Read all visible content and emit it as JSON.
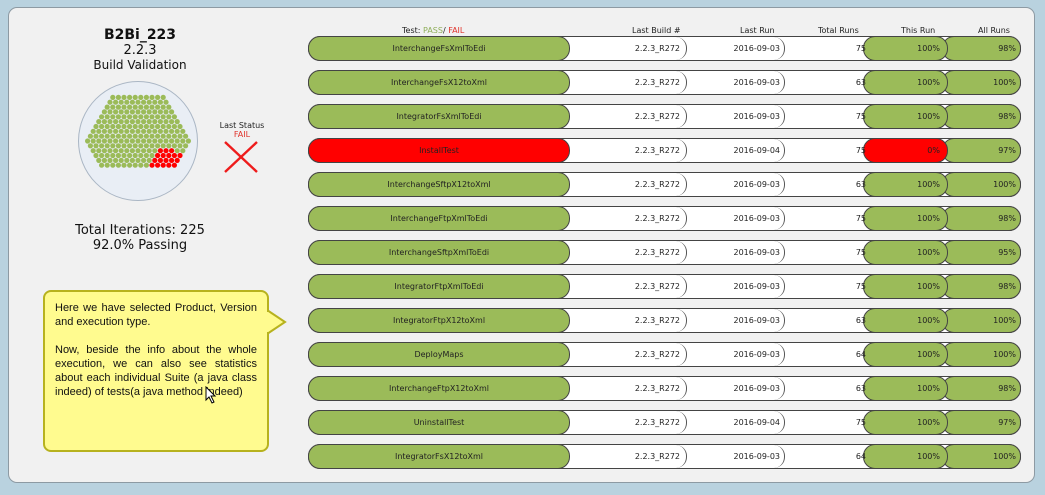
{
  "summary": {
    "product": "B2Bi_223",
    "version": "2.2.3",
    "execution_type": "Build Validation",
    "last_status_label": "Last Status",
    "last_status_value": "FAIL",
    "total_iterations": "Total Iterations: 225",
    "passing": "92.0% Passing"
  },
  "colors": {
    "pass": "#9bbb59",
    "fail": "#ff0000",
    "panel": "#f1f1f1",
    "background": "#b9d2df",
    "callout": "#fffb8f"
  },
  "headers": {
    "test_prefix": "Test: ",
    "pass": "PASS",
    "slash": "/ ",
    "fail": "FAIL",
    "last_build": "Last Build #",
    "last_run": "Last Run",
    "total_runs": "Total Runs",
    "this_run": "This Run",
    "all_runs": "All Runs"
  },
  "rows": [
    {
      "name": "InterchangeFsXmlToEdi",
      "status": "pass",
      "build": "2.2.3_R272",
      "date": "2016-09-03",
      "total": "75",
      "this_run": "100%",
      "all_runs": "98%"
    },
    {
      "name": "InterchangeFsX12toXml",
      "status": "pass",
      "build": "2.2.3_R272",
      "date": "2016-09-03",
      "total": "63",
      "this_run": "100%",
      "all_runs": "100%"
    },
    {
      "name": "IntegratorFsXmlToEdi",
      "status": "pass",
      "build": "2.2.3_R272",
      "date": "2016-09-03",
      "total": "75",
      "this_run": "100%",
      "all_runs": "98%"
    },
    {
      "name": "InstallTest",
      "status": "fail",
      "build": "2.2.3_R272",
      "date": "2016-09-04",
      "total": "75",
      "this_run": "0%",
      "all_runs": "97%"
    },
    {
      "name": "InterchangeSftpX12toXml",
      "status": "pass",
      "build": "2.2.3_R272",
      "date": "2016-09-03",
      "total": "63",
      "this_run": "100%",
      "all_runs": "100%"
    },
    {
      "name": "InterchangeFtpXmlToEdi",
      "status": "pass",
      "build": "2.2.3_R272",
      "date": "2016-09-03",
      "total": "75",
      "this_run": "100%",
      "all_runs": "98%"
    },
    {
      "name": "InterchangeSftpXmlToEdi",
      "status": "pass",
      "build": "2.2.3_R272",
      "date": "2016-09-03",
      "total": "75",
      "this_run": "100%",
      "all_runs": "95%"
    },
    {
      "name": "IntegratorFtpXmlToEdi",
      "status": "pass",
      "build": "2.2.3_R272",
      "date": "2016-09-03",
      "total": "75",
      "this_run": "100%",
      "all_runs": "98%"
    },
    {
      "name": "IntegratorFtpX12toXml",
      "status": "pass",
      "build": "2.2.3_R272",
      "date": "2016-09-03",
      "total": "63",
      "this_run": "100%",
      "all_runs": "100%"
    },
    {
      "name": "DeployMaps",
      "status": "pass",
      "build": "2.2.3_R272",
      "date": "2016-09-03",
      "total": "64",
      "this_run": "100%",
      "all_runs": "100%"
    },
    {
      "name": "InterchangeFtpX12toXml",
      "status": "pass",
      "build": "2.2.3_R272",
      "date": "2016-09-03",
      "total": "63",
      "this_run": "100%",
      "all_runs": "98%"
    },
    {
      "name": "UninstallTest",
      "status": "pass",
      "build": "2.2.3_R272",
      "date": "2016-09-04",
      "total": "75",
      "this_run": "100%",
      "all_runs": "97%"
    },
    {
      "name": "IntegratorFsX12toXml",
      "status": "pass",
      "build": "2.2.3_R272",
      "date": "2016-09-03",
      "total": "64",
      "this_run": "100%",
      "all_runs": "100%"
    }
  ],
  "iteration_dots": {
    "total": 225,
    "passed": 207,
    "failed": 18
  },
  "callout": {
    "paragraph1": "Here we have selected Product, Version and execution type.",
    "paragraph2": "Now, beside the info about the whole execution, we can also see statistics about each individual Suite (a java class indeed) of tests(a java method indeed)"
  }
}
